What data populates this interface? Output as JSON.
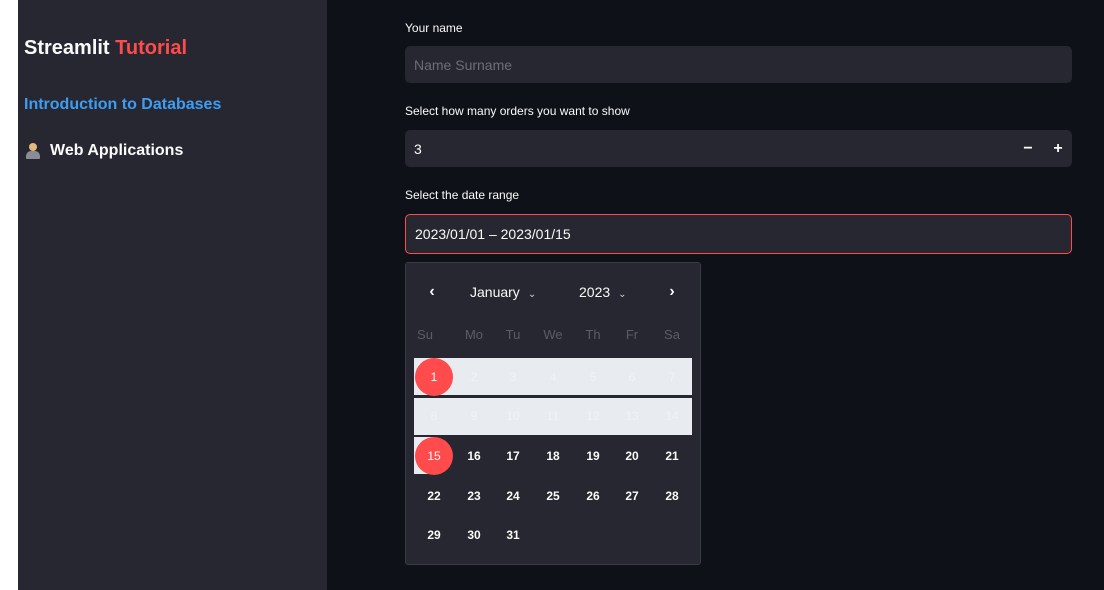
{
  "sidebar": {
    "brand_main": "Streamlit",
    "brand_accent": "Tutorial",
    "nav": [
      {
        "label": "Introduction to Databases"
      },
      {
        "label": "Web Applications",
        "icon": "technologist-emoji"
      }
    ]
  },
  "form": {
    "name_label": "Your name",
    "name_placeholder": "Name Surname",
    "orders_label": "Select how many orders you want to show",
    "orders_value": "3",
    "minus_symbol": "−",
    "plus_symbol": "+",
    "date_label": "Select the date range",
    "date_value": "2023/01/01 – 2023/01/15"
  },
  "calendar": {
    "prev_symbol": "‹",
    "next_symbol": "›",
    "month": "January",
    "year": "2023",
    "caret": "⌄",
    "weekdays": [
      "Su",
      "Mo",
      "Tu",
      "We",
      "Th",
      "Fr",
      "Sa"
    ],
    "weeks": [
      [
        "1",
        "2",
        "3",
        "4",
        "5",
        "6",
        "7"
      ],
      [
        "8",
        "9",
        "10",
        "11",
        "12",
        "13",
        "14"
      ],
      [
        "15",
        "16",
        "17",
        "18",
        "19",
        "20",
        "21"
      ],
      [
        "22",
        "23",
        "24",
        "25",
        "26",
        "27",
        "28"
      ],
      [
        "29",
        "30",
        "31"
      ]
    ],
    "range_start": "1",
    "range_end": "15"
  },
  "colors": {
    "accent": "#ff4b4b",
    "link": "#3d9df3",
    "sidebar_bg": "#262730",
    "main_bg": "#0e1117",
    "range_bg": "#e8ecf1"
  }
}
